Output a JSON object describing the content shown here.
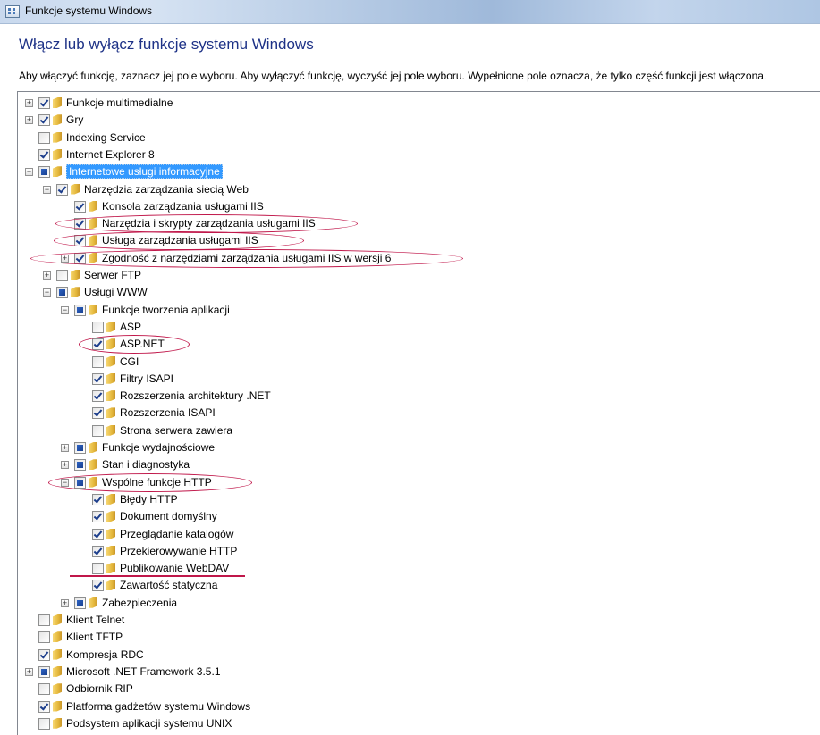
{
  "window": {
    "title": "Funkcje systemu Windows",
    "heading": "Włącz lub wyłącz funkcje systemu Windows",
    "description": "Aby włączyć funkcję, zaznacz jej pole wyboru. Aby wyłączyć funkcję, wyczyść jej pole wyboru. Wypełnione pole oznacza, że tylko część funkcji jest włączona."
  },
  "colors": {
    "heading": "#1e3287",
    "selection": "#3399ff",
    "annotation": "#c0174a",
    "check": "#1c3e8c"
  },
  "tree": [
    {
      "label": "Funkcje multimedialne",
      "level": 0,
      "expander": "plus",
      "check": "checked"
    },
    {
      "label": "Gry",
      "level": 0,
      "expander": "plus",
      "check": "checked"
    },
    {
      "label": "Indexing Service",
      "level": 0,
      "expander": "none",
      "check": "unchecked"
    },
    {
      "label": "Internet Explorer 8",
      "level": 0,
      "expander": "none",
      "check": "checked"
    },
    {
      "label": "Internetowe usługi informacyjne",
      "level": 0,
      "expander": "minus",
      "check": "partial",
      "selected": true
    },
    {
      "label": "Narzędzia zarządzania siecią Web",
      "level": 1,
      "expander": "minus",
      "check": "checked"
    },
    {
      "label": "Konsola zarządzania usługami IIS",
      "level": 2,
      "expander": "none",
      "check": "checked"
    },
    {
      "label": "Narzędzia i skrypty zarządzania usługami IIS",
      "level": 2,
      "expander": "none",
      "check": "checked",
      "annotated": true
    },
    {
      "label": "Usługa zarządzania usługami IIS",
      "level": 2,
      "expander": "none",
      "check": "checked",
      "annotated": true
    },
    {
      "label": "Zgodność z narzędziami zarządzania usługami IIS w wersji 6",
      "level": 2,
      "expander": "plus",
      "check": "checked",
      "annotated": true
    },
    {
      "label": "Serwer FTP",
      "level": 1,
      "expander": "plus",
      "check": "unchecked"
    },
    {
      "label": "Usługi WWW",
      "level": 1,
      "expander": "minus",
      "check": "partial"
    },
    {
      "label": "Funkcje tworzenia aplikacji",
      "level": 2,
      "expander": "minus",
      "check": "partial"
    },
    {
      "label": "ASP",
      "level": 3,
      "expander": "none",
      "check": "unchecked"
    },
    {
      "label": "ASP.NET",
      "level": 3,
      "expander": "none",
      "check": "checked",
      "annotated": true
    },
    {
      "label": "CGI",
      "level": 3,
      "expander": "none",
      "check": "unchecked"
    },
    {
      "label": "Filtry ISAPI",
      "level": 3,
      "expander": "none",
      "check": "checked"
    },
    {
      "label": "Rozszerzenia architektury .NET",
      "level": 3,
      "expander": "none",
      "check": "checked"
    },
    {
      "label": "Rozszerzenia ISAPI",
      "level": 3,
      "expander": "none",
      "check": "checked"
    },
    {
      "label": "Strona serwera zawiera",
      "level": 3,
      "expander": "none",
      "check": "unchecked"
    },
    {
      "label": "Funkcje wydajnościowe",
      "level": 2,
      "expander": "plus",
      "check": "partial"
    },
    {
      "label": "Stan i diagnostyka",
      "level": 2,
      "expander": "plus",
      "check": "partial"
    },
    {
      "label": "Wspólne funkcje HTTP",
      "level": 2,
      "expander": "minus",
      "check": "partial",
      "annotated": true
    },
    {
      "label": "Błędy HTTP",
      "level": 3,
      "expander": "none",
      "check": "checked"
    },
    {
      "label": "Dokument domyślny",
      "level": 3,
      "expander": "none",
      "check": "checked"
    },
    {
      "label": "Przeglądanie katalogów",
      "level": 3,
      "expander": "none",
      "check": "checked"
    },
    {
      "label": "Przekierowywanie HTTP",
      "level": 3,
      "expander": "none",
      "check": "checked"
    },
    {
      "label": "Publikowanie WebDAV",
      "level": 3,
      "expander": "none",
      "check": "unchecked",
      "underlined": true
    },
    {
      "label": "Zawartość statyczna",
      "level": 3,
      "expander": "none",
      "check": "checked"
    },
    {
      "label": "Zabezpieczenia",
      "level": 2,
      "expander": "plus",
      "check": "partial"
    },
    {
      "label": "Klient Telnet",
      "level": 0,
      "expander": "none",
      "check": "unchecked"
    },
    {
      "label": "Klient TFTP",
      "level": 0,
      "expander": "none",
      "check": "unchecked"
    },
    {
      "label": "Kompresja RDC",
      "level": 0,
      "expander": "none",
      "check": "checked"
    },
    {
      "label": "Microsoft .NET Framework 3.5.1",
      "level": 0,
      "expander": "plus",
      "check": "partial"
    },
    {
      "label": "Odbiornik RIP",
      "level": 0,
      "expander": "none",
      "check": "unchecked"
    },
    {
      "label": "Platforma gadżetów systemu Windows",
      "level": 0,
      "expander": "none",
      "check": "checked"
    },
    {
      "label": "Podsystem aplikacji systemu UNIX",
      "level": 0,
      "expander": "none",
      "check": "unchecked"
    }
  ]
}
